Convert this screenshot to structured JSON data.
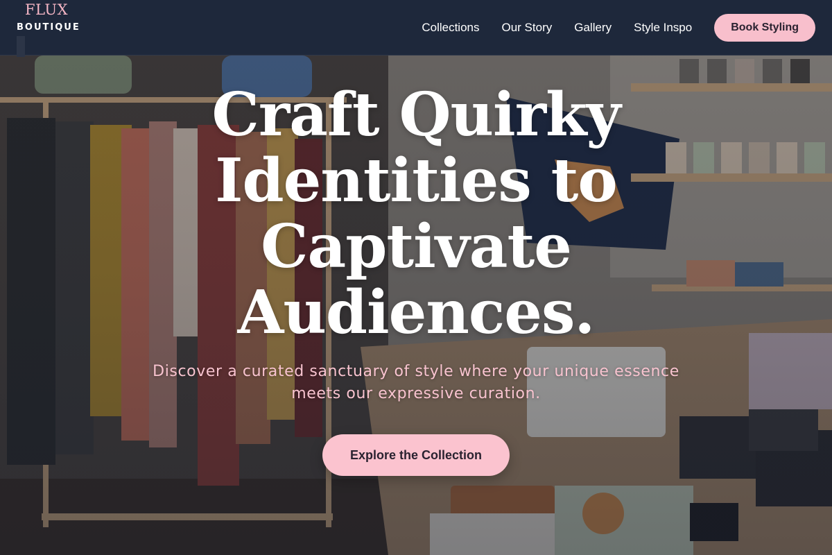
{
  "brand": {
    "mark": "FLUX",
    "name": "BOUTIQUE"
  },
  "nav": {
    "links": [
      "Collections",
      "Our Story",
      "Gallery",
      "Style Inspo"
    ],
    "cta_label": "Book Styling"
  },
  "hero": {
    "title": "Craft Quirky Identities to Captivate Audiences.",
    "subtitle": "Discover a curated sanctuary of style where your unique essence meets our expressive curation.",
    "cta_label": "Explore the Collection"
  },
  "colors": {
    "header_bg": "#1c263a",
    "accent_pink": "#f8bfcc",
    "subtitle_pink": "#f8c3cf",
    "title_white": "#ffffff"
  }
}
